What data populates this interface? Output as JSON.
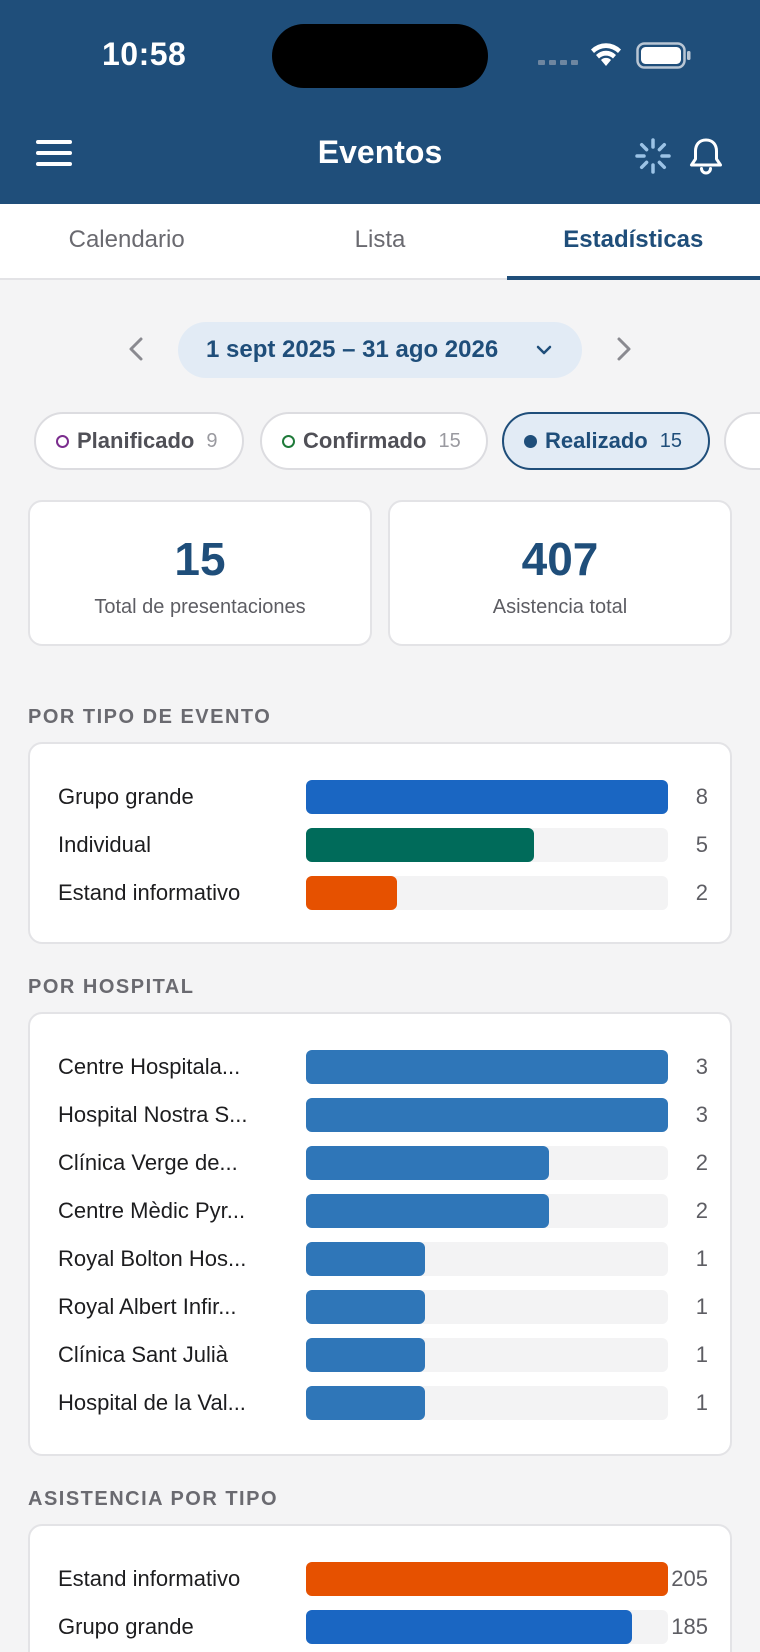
{
  "status_bar": {
    "time": "10:58"
  },
  "header": {
    "title": "Eventos",
    "menu_icon": "hamburger-menu-icon",
    "loading_icon": "spinner-icon",
    "notifications_icon": "bell-icon"
  },
  "tabs": [
    {
      "label": "Calendario",
      "active": false
    },
    {
      "label": "Lista",
      "active": false
    },
    {
      "label": "Estadísticas",
      "active": true
    }
  ],
  "date_range": {
    "label": "1 sept 2025 – 31 ago 2026"
  },
  "filters": [
    {
      "label": "Planificado",
      "count": "9",
      "color": "#7b2d8e",
      "active": false
    },
    {
      "label": "Confirmado",
      "count": "15",
      "color": "#1f7a3a",
      "active": false
    },
    {
      "label": "Realizado",
      "count": "15",
      "color": "#1f4e7a",
      "active": true
    }
  ],
  "summary": {
    "total_presentations": {
      "value": "15",
      "label": "Total de presentaciones"
    },
    "total_attendance": {
      "value": "407",
      "label": "Asistencia total"
    }
  },
  "by_event_type": {
    "title": "POR TIPO DE EVENTO",
    "rows": [
      {
        "name": "Grupo grande",
        "value": "8",
        "fraction": 1.0,
        "color": "#1a66c2"
      },
      {
        "name": "Individual",
        "value": "5",
        "fraction": 0.63,
        "color": "#006b5a"
      },
      {
        "name": "Estand informativo",
        "value": "2",
        "fraction": 0.25,
        "color": "#e65100"
      }
    ]
  },
  "by_hospital": {
    "title": "POR HOSPITAL",
    "rows": [
      {
        "name": "Centre Hospitala...",
        "value": "3",
        "fraction": 1.0,
        "color": "#2f76b8"
      },
      {
        "name": "Hospital Nostra S...",
        "value": "3",
        "fraction": 1.0,
        "color": "#2f76b8"
      },
      {
        "name": "Clínica Verge de...",
        "value": "2",
        "fraction": 0.67,
        "color": "#2f76b8"
      },
      {
        "name": "Centre Mèdic Pyr...",
        "value": "2",
        "fraction": 0.67,
        "color": "#2f76b8"
      },
      {
        "name": "Royal Bolton Hos...",
        "value": "1",
        "fraction": 0.33,
        "color": "#2f76b8"
      },
      {
        "name": "Royal Albert Infir...",
        "value": "1",
        "fraction": 0.33,
        "color": "#2f76b8"
      },
      {
        "name": "Clínica Sant Julià",
        "value": "1",
        "fraction": 0.33,
        "color": "#2f76b8"
      },
      {
        "name": "Hospital de la Val...",
        "value": "1",
        "fraction": 0.33,
        "color": "#2f76b8"
      }
    ]
  },
  "attendance_by_type": {
    "title": "ASISTENCIA POR TIPO",
    "rows": [
      {
        "name": "Estand informativo",
        "value": "205",
        "fraction": 1.0,
        "color": "#e65100"
      },
      {
        "name": "Grupo grande",
        "value": "185",
        "fraction": 0.9,
        "color": "#1a66c2"
      }
    ]
  }
}
